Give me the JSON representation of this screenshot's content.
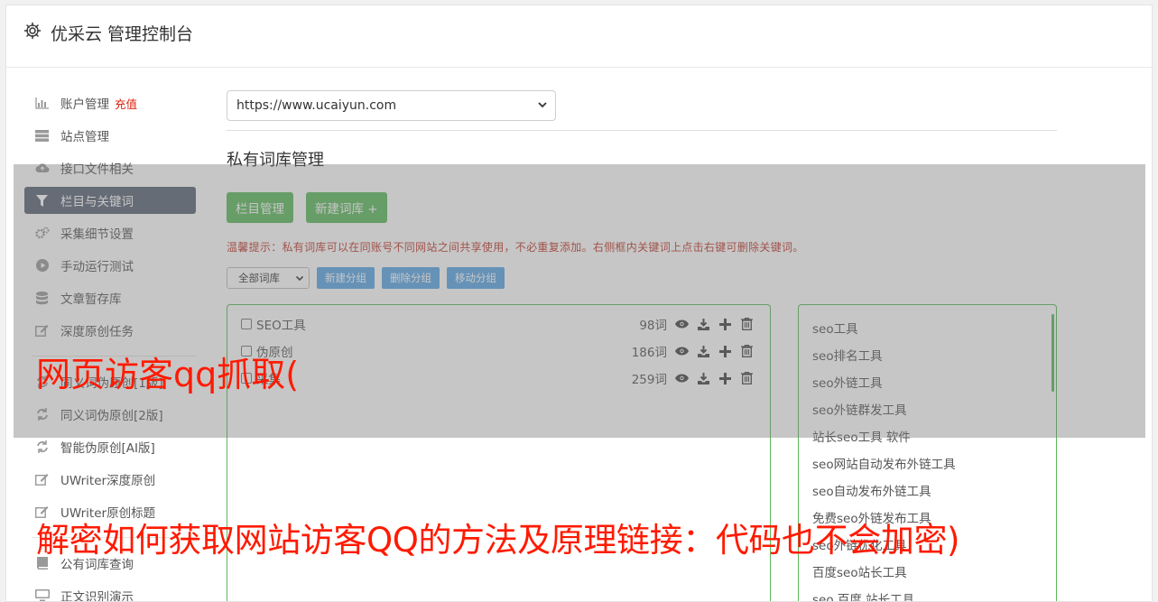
{
  "header": {
    "title": "优采云 管理控制台",
    "icon": "gear-icon"
  },
  "sidebar": {
    "items": [
      {
        "icon": "bar-chart-icon",
        "label": "账户管理",
        "badge": "充值"
      },
      {
        "icon": "server-icon",
        "label": "站点管理"
      },
      {
        "icon": "cloud-upload-icon",
        "label": "接口文件相关"
      },
      {
        "icon": "filter-icon",
        "label": "栏目与关键词",
        "active": true
      },
      {
        "icon": "cogs-icon",
        "label": "采集细节设置"
      },
      {
        "icon": "play-circle-icon",
        "label": "手动运行测试"
      },
      {
        "icon": "database-icon",
        "label": "文章暂存库"
      },
      {
        "icon": "edit-icon",
        "label": "深度原创任务"
      },
      {
        "icon": "refresh-icon",
        "label": "同义词伪原创[1版]"
      },
      {
        "icon": "refresh-icon",
        "label": "同义词伪原创[2版]"
      },
      {
        "icon": "refresh-icon",
        "label": "智能伪原创[AI版]"
      },
      {
        "icon": "edit-icon",
        "label": "UWriter深度原创"
      },
      {
        "icon": "edit-icon",
        "label": "UWriter原创标题"
      },
      {
        "icon": "book-icon",
        "label": "公有词库查询"
      },
      {
        "icon": "monitor-icon",
        "label": "正文识别演示"
      }
    ]
  },
  "main": {
    "site_select": "https://www.ucaiyun.com",
    "section_title": "私有词库管理",
    "buttons": {
      "column_manage": "栏目管理",
      "new_library": "新建词库 +"
    },
    "tip": "温馨提示：私有词库可以在同账号不同网站之间共享使用，不必重复添加。右侧框内关键词上点击右键可删除关键词。",
    "toolbar": {
      "group_select": "全部词库",
      "new_group": "新建分组",
      "delete_group": "删除分组",
      "move_group": "移动分组"
    },
    "libraries": [
      {
        "name": "SEO工具",
        "count": "98词"
      },
      {
        "name": "伪原创",
        "count": "186词"
      },
      {
        "name": "采集",
        "count": "259词"
      }
    ],
    "keywords": [
      "seo工具",
      "seo排名工具",
      "seo外链工具",
      "seo外链群发工具",
      "站长seo工具 软件",
      "seo网站自动发布外链工具",
      "seo自动发布外链工具",
      "免费seo外链发布工具",
      "seo外链优化工具",
      "百度seo站长工具",
      "seo 百度 站长工具"
    ]
  },
  "overlay": {
    "line1": "网页访客qq抓取(",
    "line2": "解密如何获取网站访客QQ的方法及原理链接：代码也不会加密)"
  },
  "colors": {
    "green": "#5cb85c",
    "blue": "#5aa5e6",
    "active_nav": "#5a6575",
    "overlay_text": "#ff1a00",
    "tip": "#c0392b"
  }
}
